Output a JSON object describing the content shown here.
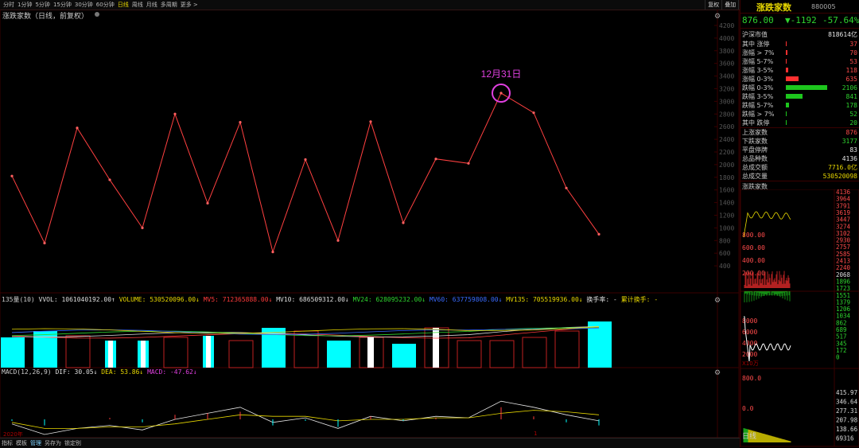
{
  "toolbar": {
    "periods": [
      "分时",
      "1分钟",
      "5分钟",
      "15分钟",
      "30分钟",
      "60分钟",
      "日线",
      "周线",
      "月线",
      "多周期",
      "更多 >"
    ],
    "active_period": "日线",
    "tools": [
      "复权",
      "叠加",
      "历史",
      "统计",
      "画线",
      "F10",
      "标记",
      "+自选",
      "返回"
    ]
  },
  "chart": {
    "title": "涨跌家数（日线，前复权）",
    "annotation_label": "12月31日",
    "y_ticks": [
      "4200",
      "4000",
      "3800",
      "3600",
      "3400",
      "3200",
      "3000",
      "2800",
      "2600",
      "2400",
      "2200",
      "2000",
      "1800",
      "1600",
      "1400",
      "1200",
      "1000",
      "800",
      "600",
      "400"
    ]
  },
  "chart_data": {
    "type": "line",
    "x": [
      1,
      2,
      3,
      4,
      5,
      6,
      7,
      8,
      9,
      10,
      11,
      12,
      13,
      14,
      15,
      16,
      17,
      18,
      19
    ],
    "values": [
      1820,
      760,
      2580,
      1760,
      1000,
      2800,
      1390,
      2670,
      620,
      2080,
      800,
      2680,
      1080,
      2090,
      2020,
      3130,
      2820,
      1630,
      900
    ],
    "highlight_label": "12月31日",
    "highlight_index": 15,
    "ylim": [
      200,
      4300
    ]
  },
  "volume": {
    "period_label": "135量(10)",
    "vvol": "VVOL: 1061040192.00↑",
    "volume": "VOLUME: 530520096.00↓",
    "mv5": "MV5: 712365888.00↓",
    "mv10": "MV10: 686509312.00↓",
    "mv24": "MV24: 628095232.00↓",
    "mv60": "MV60: 637759808.00↓",
    "mv135": "MV135: 705519936.00↓",
    "turnover": "换手率: -",
    "cum_turnover": "累计换手: -"
  },
  "macd": {
    "name": "MACD(12,26,9)",
    "dif": "DIF: 30.05↓",
    "dea": "DEA: 53.86↓",
    "macd": "MACD: -47.62↓",
    "x_label_left": "2020年",
    "x_label_mid": "1"
  },
  "bottom_tabs": [
    "指标",
    "模板",
    "管理",
    "另存为",
    "锁定别"
  ],
  "bottom_active": "管理",
  "right": {
    "name": "涨跌家数",
    "code": "880005",
    "price": "876.00",
    "change": "▼-1192",
    "pct": "-57.64%",
    "market_cap_label": "沪深市值",
    "market_cap": "818614亿",
    "dist": [
      {
        "label": "其中 涨停",
        "value": "37",
        "color": "red",
        "bar": 0.02
      },
      {
        "label": "涨幅 > 7%",
        "value": "70",
        "color": "red",
        "bar": 0.03
      },
      {
        "label": "涨幅 5-7%",
        "value": "53",
        "color": "red",
        "bar": 0.025
      },
      {
        "label": "涨幅 3-5%",
        "value": "118",
        "color": "red",
        "bar": 0.06
      },
      {
        "label": "涨幅 0-3%",
        "value": "635",
        "color": "red",
        "bar": 0.3
      },
      {
        "label": "跌幅 0-3%",
        "value": "2106",
        "color": "green",
        "bar": 1.0
      },
      {
        "label": "跌幅 3-5%",
        "value": "841",
        "color": "green",
        "bar": 0.4
      },
      {
        "label": "跌幅 5-7%",
        "value": "178",
        "color": "green",
        "bar": 0.085
      },
      {
        "label": "跌幅 > 7%",
        "value": "52",
        "color": "green",
        "bar": 0.025
      },
      {
        "label": "其中 跌停",
        "value": "20",
        "color": "green",
        "bar": 0.01
      }
    ],
    "stats": [
      {
        "label": "上涨家数",
        "value": "876",
        "color": "red"
      },
      {
        "label": "下跌家数",
        "value": "3177",
        "color": "green"
      },
      {
        "label": "平盘停牌",
        "value": "83",
        "color": "white"
      },
      {
        "label": "总品种数",
        "value": "4136",
        "color": "white"
      },
      {
        "label": "总成交额",
        "value": "7716.0亿",
        "color": "yellow"
      },
      {
        "label": "总成交量",
        "value": "530520098",
        "color": "yellow"
      }
    ],
    "mini_title": "涨跌家数",
    "mini_left_ticks": [
      "800.00",
      "600.00",
      "400.00",
      "200.00"
    ],
    "mini_right_ticks": [
      "4136",
      "3964",
      "3791",
      "3619",
      "3447",
      "3274",
      "3102",
      "2930",
      "2757",
      "2585",
      "2413",
      "2240",
      "2068",
      "1896",
      "1723",
      "1551",
      "1379",
      "1206",
      "1034",
      "862",
      "689",
      "517",
      "345",
      "172",
      "0"
    ],
    "mini_vol_ticks": [
      "8000",
      "6000",
      "4000",
      "2000"
    ],
    "mini_vol_unit": "X10万",
    "mini_macd_ticks": [
      "800.0",
      "0.0"
    ],
    "mini_macd_right": [
      "415.97",
      "346.64",
      "277.31",
      "207.98",
      "138.66",
      "69316"
    ],
    "mini_bottom": "日线"
  }
}
